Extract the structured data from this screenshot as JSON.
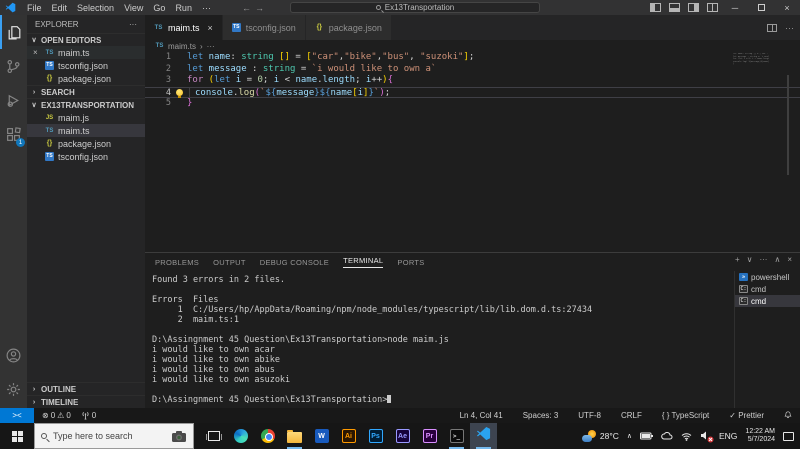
{
  "titlebar": {
    "menus": [
      "File",
      "Edit",
      "Selection",
      "View",
      "Go",
      "Run",
      "···"
    ],
    "nav_back": "←",
    "nav_forward": "→",
    "search": "Ex13Transportation",
    "window_controls": {
      "minimize": "─",
      "restore": "▢",
      "close": "×"
    }
  },
  "activity_bar": {
    "top": [
      {
        "name": "explorer",
        "active": true
      },
      {
        "name": "source-control",
        "active": false
      },
      {
        "name": "run-and-debug",
        "active": false
      },
      {
        "name": "extensions",
        "active": false,
        "badge": "1"
      }
    ],
    "bottom": [
      {
        "name": "account"
      },
      {
        "name": "settings"
      }
    ]
  },
  "sidebar": {
    "title": "EXPLORER",
    "more": "···",
    "sections": [
      {
        "label": "OPEN EDITORS",
        "expanded": true,
        "items": [
          {
            "label": "maim.ts",
            "icon": "ts",
            "close": true,
            "active": true
          },
          {
            "label": "tsconfig.json",
            "icon": "tstile"
          },
          {
            "label": "package.json",
            "icon": "json"
          }
        ]
      },
      {
        "label": "SEARCH",
        "expanded": false,
        "items": []
      },
      {
        "label": "EX13TRANSPORTATION",
        "expanded": true,
        "items": [
          {
            "label": "maim.js",
            "icon": "js"
          },
          {
            "label": "maim.ts",
            "icon": "ts",
            "selected": true
          },
          {
            "label": "package.json",
            "icon": "json"
          },
          {
            "label": "tsconfig.json",
            "icon": "tstile"
          }
        ]
      }
    ],
    "bottom_sections": [
      "OUTLINE",
      "TIMELINE"
    ]
  },
  "editor_tabs": [
    {
      "label": "maim.ts",
      "icon": "ts",
      "active": true,
      "close": "×"
    },
    {
      "label": "tsconfig.json",
      "icon": "tstile",
      "active": false
    },
    {
      "label": "package.json",
      "icon": "json",
      "active": false
    }
  ],
  "breadcrumb": {
    "file": "maim.ts",
    "sep": "›",
    "tail": "···"
  },
  "code": {
    "lines": [
      {
        "n": "1",
        "tokens": [
          [
            "let",
            "kw"
          ],
          [
            " name",
            "vr"
          ],
          [
            ":",
            "pn"
          ],
          [
            " string",
            "ty"
          ],
          [
            " []",
            "bk"
          ],
          [
            " = ",
            "pn"
          ],
          [
            "[",
            "bk"
          ],
          [
            "\"car\"",
            "st"
          ],
          [
            ",",
            "pn"
          ],
          [
            "\"bike\"",
            "st"
          ],
          [
            ",",
            "pn"
          ],
          [
            "\"bus\"",
            "st"
          ],
          [
            ", ",
            "pn"
          ],
          [
            "\"suzoki\"",
            "st"
          ],
          [
            "]",
            "bk"
          ],
          [
            ";",
            "pn"
          ]
        ]
      },
      {
        "n": "2",
        "tokens": [
          [
            "let",
            "kw"
          ],
          [
            " message",
            "vr"
          ],
          [
            " : ",
            "pn"
          ],
          [
            "string",
            "ty"
          ],
          [
            " = ",
            "pn"
          ],
          [
            "`i would like to own a`",
            "st"
          ]
        ]
      },
      {
        "n": "3",
        "tokens": [
          [
            "for",
            "ct"
          ],
          [
            " (",
            "bk"
          ],
          [
            "let",
            "kw"
          ],
          [
            " i",
            "vr"
          ],
          [
            " = ",
            "pn"
          ],
          [
            "0",
            "nm"
          ],
          [
            "; ",
            "pn"
          ],
          [
            "i",
            "vr"
          ],
          [
            " < ",
            "pn"
          ],
          [
            "name",
            "vr"
          ],
          [
            ".",
            "pn"
          ],
          [
            "length",
            "vr"
          ],
          [
            "; ",
            "pn"
          ],
          [
            "i",
            "vr"
          ],
          [
            "++",
            "pn"
          ],
          [
            ")",
            "bk"
          ],
          [
            "{",
            "pu"
          ]
        ]
      },
      {
        "n": "4",
        "current": true,
        "bulb": true,
        "guide": true,
        "tokens": [
          [
            "console",
            "vr"
          ],
          [
            ".",
            "pn"
          ],
          [
            "log",
            "fn"
          ],
          [
            "(",
            "pu"
          ],
          [
            "`",
            "st"
          ],
          [
            "${",
            "kw"
          ],
          [
            "message",
            "vr"
          ],
          [
            "}",
            "kw"
          ],
          [
            "${",
            "kw"
          ],
          [
            "name",
            "vr"
          ],
          [
            "[",
            "bk"
          ],
          [
            "i",
            "vr"
          ],
          [
            "]",
            "bk"
          ],
          [
            "}",
            "kw"
          ],
          [
            "`",
            "st"
          ],
          [
            ")",
            "pu"
          ],
          [
            ";",
            "pn"
          ]
        ]
      },
      {
        "n": "5",
        "tokens": [
          [
            "}",
            "pu"
          ]
        ]
      }
    ]
  },
  "panel": {
    "tabs": [
      {
        "label": "PROBLEMS",
        "active": false
      },
      {
        "label": "OUTPUT",
        "active": false
      },
      {
        "label": "DEBUG CONSOLE",
        "active": false
      },
      {
        "label": "TERMINAL",
        "active": true
      },
      {
        "label": "PORTS",
        "active": false
      }
    ],
    "actions": [
      "+",
      "∨",
      "···",
      "∧",
      "×"
    ]
  },
  "terminal": {
    "lines": [
      "Found 3 errors in 2 files.",
      "",
      "Errors  Files",
      "     1  C:/Users/hp/AppData/Roaming/npm/node_modules/typescript/lib/lib.dom.d.ts:27434",
      "     2  maim.ts:1",
      "",
      "D:\\Assingnment 45 Question\\Ex13Transportation>node maim.js",
      "i would like to own acar",
      "i would like to own abike",
      "i would like to own abus",
      "i would like to own asuzoki",
      "",
      "D:\\Assingnment 45 Question\\Ex13Transportation>"
    ],
    "cursor": true,
    "list": [
      {
        "label": "powershell",
        "icon": "ps",
        "selected": false
      },
      {
        "label": "cmd",
        "icon": "cmd",
        "selected": false
      },
      {
        "label": "cmd",
        "icon": "cmd",
        "selected": true
      }
    ]
  },
  "statusbar": {
    "remote": "><",
    "errors_icon": "⊗",
    "errors": "0",
    "warnings_icon": "⚠",
    "warnings": "0",
    "ports": "0",
    "right": [
      "Ln 4, Col 41",
      "Spaces: 3",
      "UTF-8",
      "CRLF",
      "{ } TypeScript",
      "✓ Prettier"
    ]
  },
  "taskbar": {
    "search_placeholder": "Type here to search",
    "apps": [
      {
        "name": "task-view"
      },
      {
        "name": "edge"
      },
      {
        "name": "chrome"
      },
      {
        "name": "file-explorer",
        "open": true
      },
      {
        "name": "word",
        "label": "W"
      },
      {
        "name": "illustrator",
        "label": "Ai"
      },
      {
        "name": "photoshop",
        "label": "Ps"
      },
      {
        "name": "after-effects",
        "label": "Ae"
      },
      {
        "name": "premiere",
        "label": "Pr"
      },
      {
        "name": "terminal",
        "label": ">_",
        "open": true
      },
      {
        "name": "vscode",
        "active": true,
        "open": true
      }
    ],
    "tray": {
      "temp": "28°C",
      "chevron": "∧",
      "lang": "ENG",
      "time": "12:22 AM",
      "date": "5/7/2024"
    }
  },
  "colors": {
    "accent_blue": "#0078d4",
    "activity_badge": "#1177bb",
    "selection_bg": "#37373d",
    "editor_bg": "#1e1e1e",
    "sidebar_bg": "#252526",
    "titlebar_bg": "#323233",
    "ts_icon": "#519aba",
    "js_icon": "#cbcb41",
    "json_icon": "#cbcb41"
  }
}
